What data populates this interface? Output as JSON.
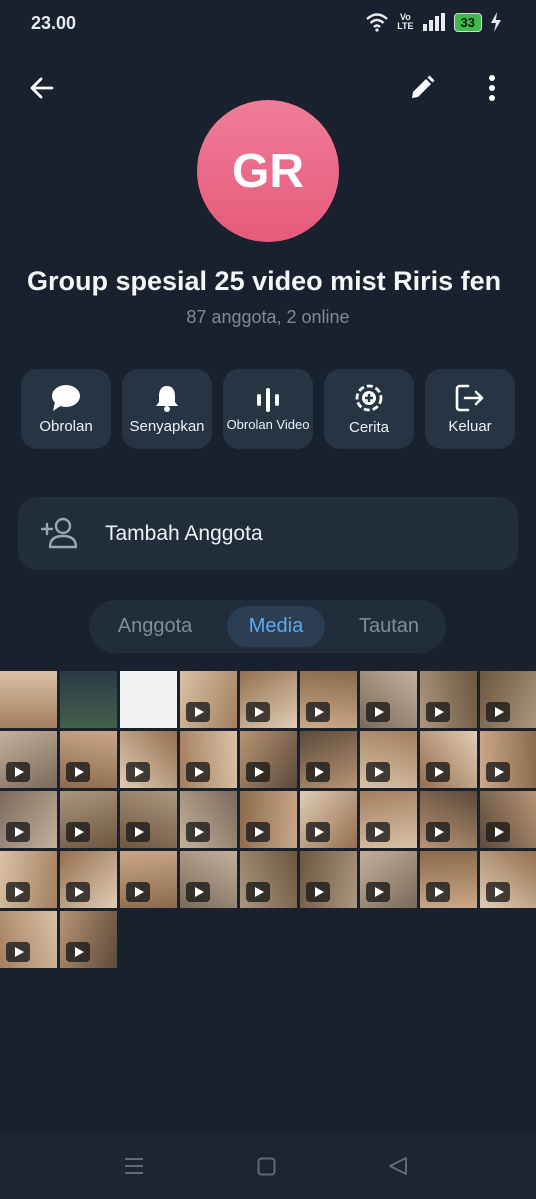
{
  "status_bar": {
    "time": "23.00",
    "network_lte_top": "Vo",
    "network_lte_bottom": "LTE",
    "battery": "33",
    "icons": [
      "wifi-icon",
      "volte-icon",
      "signal-icon",
      "battery-icon",
      "charging-icon"
    ]
  },
  "header": {
    "back_icon": "arrow-left-icon",
    "edit_icon": "pencil-icon",
    "menu_icon": "more-vertical-icon"
  },
  "profile": {
    "avatar_initials": "GR",
    "avatar_color": "#e9627f",
    "title": "Group spesial 25 video mist Riris fen",
    "subtitle": "87 anggota, 2 online"
  },
  "actions": [
    {
      "label": "Obrolan",
      "icon": "chat-bubble-icon"
    },
    {
      "label": "Senyapkan",
      "icon": "bell-icon"
    },
    {
      "label": "Obrolan Video",
      "icon": "audio-wave-icon"
    },
    {
      "label": "Cerita",
      "icon": "story-add-icon"
    },
    {
      "label": "Keluar",
      "icon": "exit-icon"
    }
  ],
  "add_member": {
    "label": "Tambah Anggota",
    "icon": "add-person-icon"
  },
  "tabs": [
    {
      "label": "Anggota",
      "active": false
    },
    {
      "label": "Media",
      "active": true
    },
    {
      "label": "Tautan",
      "active": false
    }
  ],
  "colors": {
    "background": "#18212d",
    "card": "#263443",
    "accent": "#5ea9ef",
    "muted_text": "#7d8b99"
  },
  "media_count": 38,
  "nav_bar": {
    "icons": [
      "menu-lines-icon",
      "home-square-icon",
      "back-triangle-icon"
    ]
  }
}
